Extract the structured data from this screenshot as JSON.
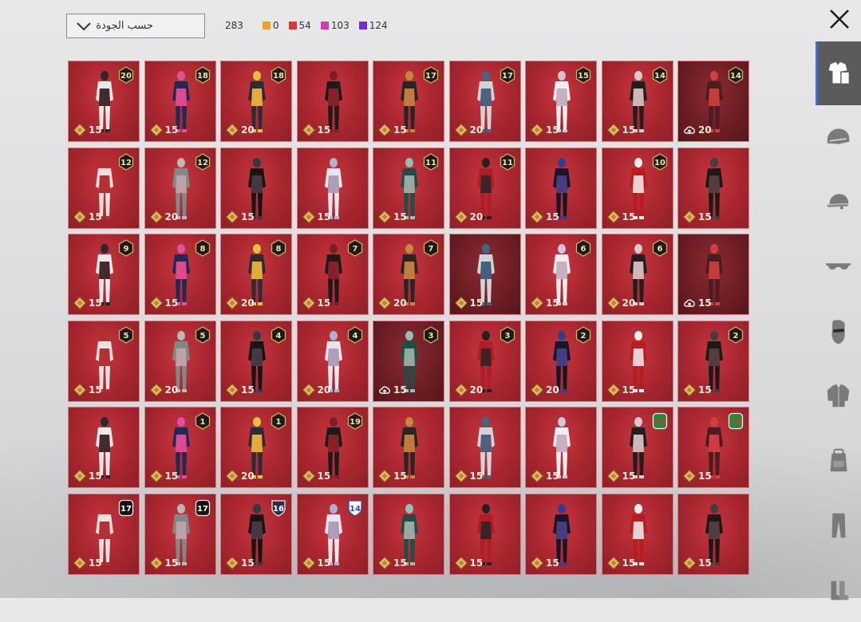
{
  "sort": {
    "label": "حسب الجودة"
  },
  "counts": {
    "total": "283",
    "items": [
      {
        "value": "0",
        "color": "#e8a32b"
      },
      {
        "value": "54",
        "color": "#d93838"
      },
      {
        "value": "103",
        "color": "#d23bb3"
      },
      {
        "value": "124",
        "color": "#7a2bd9"
      }
    ]
  },
  "sidebar": {
    "tabs": [
      {
        "icon": "outfit-icon",
        "active": true
      },
      {
        "icon": "helmet-icon",
        "active": false
      },
      {
        "icon": "cap-icon",
        "active": false
      },
      {
        "icon": "glasses-icon",
        "active": false
      },
      {
        "icon": "mask-icon",
        "active": false
      },
      {
        "icon": "jacket-icon",
        "active": false
      },
      {
        "icon": "backpack-icon",
        "active": false
      },
      {
        "icon": "pants-icon",
        "active": false
      },
      {
        "icon": "shoes-icon",
        "active": false
      }
    ]
  },
  "outfits": [
    {
      "badge": "20",
      "price": "15",
      "currency": "coin"
    },
    {
      "badge": "18",
      "price": "15",
      "currency": "coin"
    },
    {
      "badge": "18",
      "price": "20",
      "currency": "coin"
    },
    {
      "badge": "",
      "price": "15",
      "currency": "coin"
    },
    {
      "badge": "17",
      "price": "15",
      "currency": "coin"
    },
    {
      "badge": "17",
      "price": "20",
      "currency": "coin"
    },
    {
      "badge": "15",
      "price": "15",
      "currency": "coin"
    },
    {
      "badge": "14",
      "price": "15",
      "currency": "coin"
    },
    {
      "badge": "14",
      "price": "20",
      "currency": "upload",
      "dark": true
    },
    {
      "badge": "12",
      "price": "15",
      "currency": "coin"
    },
    {
      "badge": "12",
      "price": "20",
      "currency": "coin"
    },
    {
      "badge": "",
      "price": "15",
      "currency": "coin"
    },
    {
      "badge": "",
      "price": "15",
      "currency": "coin"
    },
    {
      "badge": "11",
      "price": "15",
      "currency": "coin"
    },
    {
      "badge": "11",
      "price": "20",
      "currency": "coin"
    },
    {
      "badge": "",
      "price": "15",
      "currency": "coin"
    },
    {
      "badge": "10",
      "price": "15",
      "currency": "coin"
    },
    {
      "badge": "",
      "price": "15",
      "currency": "coin"
    },
    {
      "badge": "9",
      "price": "15",
      "currency": "coin"
    },
    {
      "badge": "8",
      "price": "15",
      "currency": "coin"
    },
    {
      "badge": "8",
      "price": "20",
      "currency": "coin"
    },
    {
      "badge": "7",
      "price": "15",
      "currency": "coin"
    },
    {
      "badge": "7",
      "price": "20",
      "currency": "coin"
    },
    {
      "badge": "",
      "price": "15",
      "currency": "coin",
      "dark": true
    },
    {
      "badge": "6",
      "price": "15",
      "currency": "coin"
    },
    {
      "badge": "6",
      "price": "20",
      "currency": "coin"
    },
    {
      "badge": "",
      "price": "15",
      "currency": "upload",
      "dark": true
    },
    {
      "badge": "5",
      "price": "15",
      "currency": "coin"
    },
    {
      "badge": "5",
      "price": "20",
      "currency": "coin"
    },
    {
      "badge": "4",
      "price": "15",
      "currency": "coin"
    },
    {
      "badge": "4",
      "price": "20",
      "currency": "coin"
    },
    {
      "badge": "3",
      "price": "15",
      "currency": "upload",
      "dark": true
    },
    {
      "badge": "3",
      "price": "20",
      "currency": "coin"
    },
    {
      "badge": "2",
      "price": "20",
      "currency": "coin"
    },
    {
      "badge": "",
      "price": "15",
      "currency": "coin"
    },
    {
      "badge": "2",
      "price": "15",
      "currency": "coin"
    },
    {
      "badge": "",
      "price": "15",
      "currency": "coin"
    },
    {
      "badge": "1",
      "price": "15",
      "currency": "coin"
    },
    {
      "badge": "1",
      "price": "20",
      "currency": "coin"
    },
    {
      "badge": "19",
      "price": "15",
      "currency": "coin"
    },
    {
      "badge": "",
      "price": "15",
      "currency": "coin"
    },
    {
      "badge": "",
      "price": "15",
      "currency": "coin"
    },
    {
      "badge": "",
      "price": "15",
      "currency": "coin"
    },
    {
      "badge": "18",
      "price": "15",
      "currency": "coin",
      "badgeStyle": "season"
    },
    {
      "badge": "18",
      "price": "15",
      "currency": "coin",
      "badgeStyle": "season"
    },
    {
      "badge": "17",
      "price": "15",
      "currency": "coin",
      "badgeStyle": "rp"
    },
    {
      "badge": "17",
      "price": "15",
      "currency": "coin",
      "badgeStyle": "rp"
    },
    {
      "badge": "16",
      "price": "15",
      "currency": "coin",
      "badgeStyle": "shield"
    },
    {
      "badge": "14",
      "price": "15",
      "currency": "coin",
      "badgeStyle": "shield-white"
    },
    {
      "badge": "",
      "price": "15",
      "currency": "coin"
    },
    {
      "badge": "",
      "price": "15",
      "currency": "coin"
    },
    {
      "badge": "",
      "price": "15",
      "currency": "coin"
    },
    {
      "badge": "",
      "price": "15",
      "currency": "coin"
    },
    {
      "badge": "",
      "price": "15",
      "currency": "coin"
    }
  ]
}
